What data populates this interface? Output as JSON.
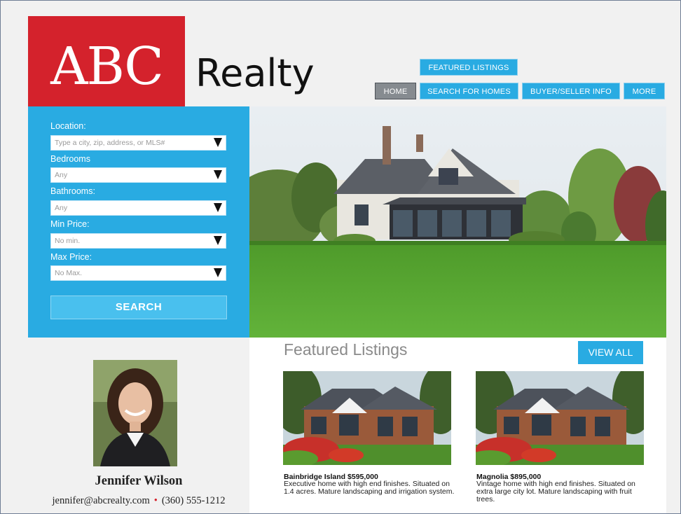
{
  "brand": {
    "logo_abc": "ABC",
    "logo_realty": "Realty",
    "red": "#d4222c",
    "blue": "#29abe2"
  },
  "nav": {
    "featured": "FEATURED LISTINGS",
    "items": [
      {
        "label": "HOME",
        "active": true
      },
      {
        "label": "SEARCH FOR HOMES"
      },
      {
        "label": "BUYER/SELLER INFO"
      },
      {
        "label": "MORE"
      }
    ]
  },
  "search": {
    "fields": [
      {
        "label": "Location:",
        "value": "Type a city, zip, address, or MLS#"
      },
      {
        "label": "Bedrooms",
        "value": "Any"
      },
      {
        "label": "Bathrooms:",
        "value": "Any"
      },
      {
        "label": "Min Price:",
        "value": "No min."
      },
      {
        "label": "Max Price:",
        "value": "No Max."
      }
    ],
    "button": "SEARCH"
  },
  "featured": {
    "title": "Featured Listings",
    "view_all": "VIEW ALL",
    "listings": [
      {
        "title": "Bainbridge Island $595,000",
        "description": "Executive home with high end finishes. Situated on 1.4 acres. Mature landscaping and irrigation system."
      },
      {
        "title": "Magnolia $895,000",
        "description": "Vintage home with high end finishes. Situated on extra large city lot. Mature landscaping with fruit trees."
      }
    ]
  },
  "agent": {
    "name": "Jennifer Wilson",
    "email": "jennifer@abcrealty.com",
    "separator": "•",
    "phone": "(360) 555-1212"
  }
}
